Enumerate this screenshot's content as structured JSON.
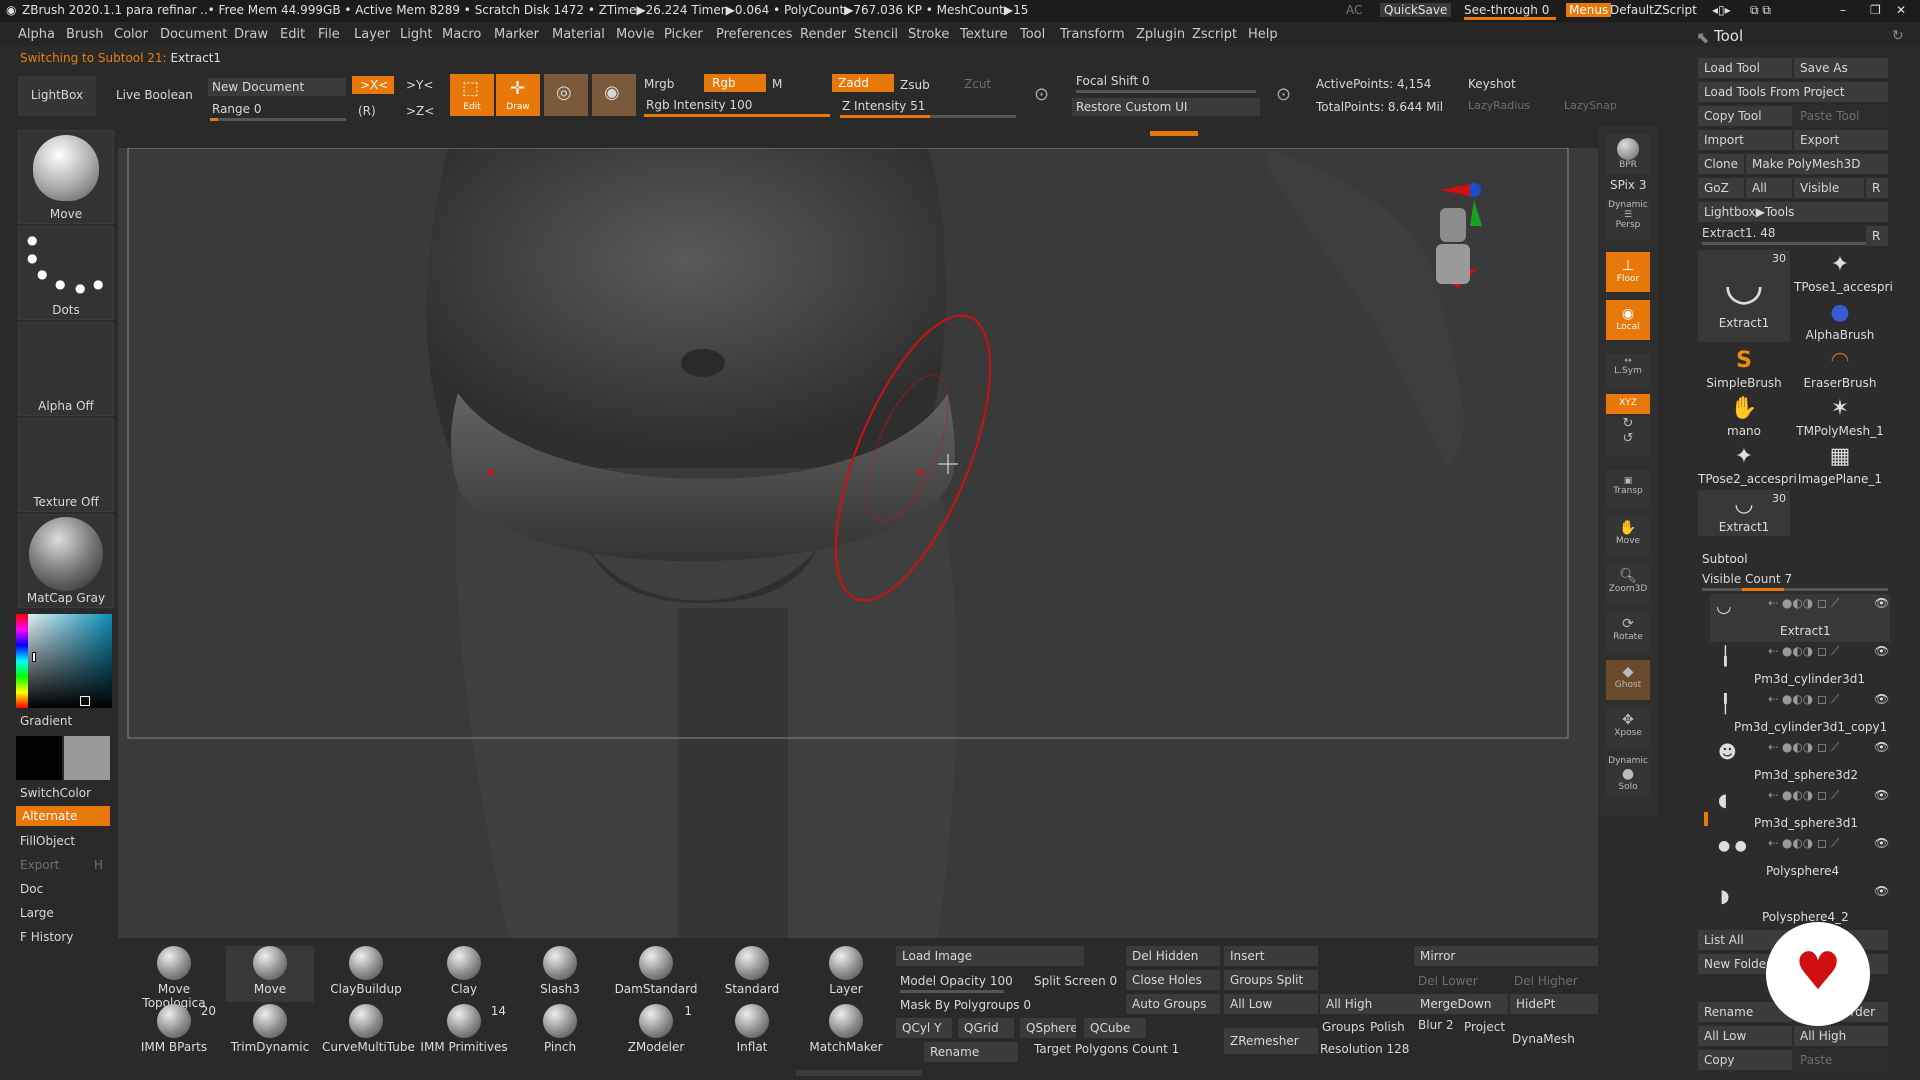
{
  "titlebar": {
    "app": "ZBrush 2020.1.1",
    "doc": "para refinar",
    "stats": "..• Free Mem 44.999GB • Active Mem 8289 • Scratch Disk 1472 • ZTime▶26.224 Timer▶0.064 • PolyCount▶767.036 KP • MeshCount▶15",
    "ac": "AC",
    "quicksave": "QuickSave",
    "see_through": "See-through",
    "see_through_val": "0",
    "menus": "Menus",
    "script": "DefaultZScript"
  },
  "menu": [
    "Alpha",
    "Brush",
    "Color",
    "Document",
    "Draw",
    "Edit",
    "File",
    "Layer",
    "Light",
    "Macro",
    "Marker",
    "Material",
    "Movie",
    "Picker",
    "Preferences",
    "Render",
    "Stencil",
    "Stroke",
    "Texture",
    "Tool",
    "Transform",
    "Zplugin",
    "Zscript",
    "Help"
  ],
  "note": {
    "prefix": "Switching to Subtool 21:",
    "name": "Extract1"
  },
  "top": {
    "lightbox": "LightBox",
    "live_boolean": "Live Boolean",
    "new_document": "New Document",
    "range": "Range 0",
    "x": ">X<",
    "y": ">Y<",
    "z": ">Z<",
    "r": "(R)",
    "edit": "Edit",
    "draw": "Draw",
    "mrgb": "Mrgb",
    "rgb": "Rgb",
    "m": "M",
    "rgb_intensity": "Rgb Intensity 100",
    "zadd": "Zadd",
    "zsub": "Zsub",
    "zcut": "Zcut",
    "z_intensity": "Z Intensity 51",
    "focal_shift": "Focal Shift 0",
    "restore_ui": "Restore Custom UI",
    "active_points": "ActivePoints: 4,154",
    "total_points": "TotalPoints: 8.644 Mil",
    "keyshot": "Keyshot",
    "lazy_radius": "LazyRadius",
    "lazy_snap": "LazySnap",
    "rgb_intensity_val": 100,
    "z_intensity_val": 51
  },
  "left": {
    "move": "Move",
    "dots": "Dots",
    "alpha_off": "Alpha Off",
    "texture_off": "Texture Off",
    "matcap": "MatCap Gray",
    "gradient": "Gradient",
    "switchcolor": "SwitchColor",
    "alternate": "Alternate",
    "fillobject": "FillObject",
    "export": "Export",
    "h": "H",
    "doc": "Doc",
    "large": "Large",
    "fhistory": "F History"
  },
  "right": {
    "bpr": "BPR",
    "spix": "SPix 3",
    "dynamic": "Dynamic",
    "persp": "Persp",
    "floor": "Floor",
    "local": "Local",
    "lsym": "L.Sym",
    "xyz": "XYZ",
    "transp": "Transp",
    "move": "Move",
    "zoom3d": "Zoom3D",
    "rotate": "Rotate",
    "ghost": "Ghost",
    "xpose": "Xpose",
    "solo": "Solo"
  },
  "tool": {
    "title": "Tool",
    "load": "Load Tool",
    "save_as": "Save As",
    "load_project": "Load Tools From Project",
    "copy": "Copy Tool",
    "paste": "Paste Tool",
    "import": "Import",
    "export": "Export",
    "clone": "Clone",
    "make_poly": "Make PolyMesh3D",
    "goz": "GoZ",
    "all": "All",
    "visible": "Visible",
    "r": "R",
    "lightbox_tools": "Lightbox▶Tools",
    "current": "Extract1. 48",
    "items": [
      {
        "name": "Extract1",
        "count": "30",
        "icon": "◡"
      },
      {
        "name": "TPose1_accespri",
        "icon": "✦"
      },
      {
        "name": "AlphaBrush",
        "icon": "●"
      },
      {
        "name": "SimpleBrush",
        "icon": "S"
      },
      {
        "name": "EraserBrush",
        "icon": "◠"
      },
      {
        "name": "mano",
        "icon": "✋"
      },
      {
        "name": "TMPolyMesh_1",
        "icon": "✶"
      },
      {
        "name": "TPose2_accespri",
        "icon": "✦"
      },
      {
        "name": "ImagePlane_1",
        "icon": "▦"
      },
      {
        "name": "Extract1",
        "count": "30",
        "icon": "◡"
      }
    ]
  },
  "subtool": {
    "title": "Subtool",
    "visible_count": "Visible Count 7",
    "items": [
      "Extract1",
      "Pm3d_cylinder3d1",
      "Pm3d_cylinder3d1_copy1",
      "Pm3d_sphere3d2",
      "Pm3d_sphere3d1",
      "Polysphere4",
      "Polysphere4_2"
    ],
    "list_all": "List All",
    "new_folder": "New Folder",
    "rename": "Rename",
    "autoreorder": "AutoReorder",
    "all_low": "All Low",
    "all_high": "All High",
    "copy": "Copy",
    "paste": "Paste"
  },
  "brushes": [
    {
      "name": "Move Topologica"
    },
    {
      "name": "Move"
    },
    {
      "name": "ClayBuildup"
    },
    {
      "name": "Clay"
    },
    {
      "name": "Slash3"
    },
    {
      "name": "DamStandard"
    },
    {
      "name": "Standard"
    },
    {
      "name": "Layer"
    },
    {
      "name": "IMM BParts",
      "count": "20"
    },
    {
      "name": "TrimDynamic"
    },
    {
      "name": "CurveMultiTube"
    },
    {
      "name": "IMM Primitives",
      "count": "14"
    },
    {
      "name": "Pinch"
    },
    {
      "name": "ZModeler",
      "count": "1"
    },
    {
      "name": "Inflat"
    },
    {
      "name": "MatchMaker"
    }
  ],
  "bottom": {
    "load_image": "Load Image",
    "model_opacity": "Model Opacity 100",
    "split_screen": "Split Screen 0",
    "mask_polygroups": "Mask By Polygroups 0",
    "qcyl": "QCyl Y",
    "qgrid": "QGrid",
    "qsphere": "QSphere",
    "qcube": "QCube",
    "rename": "Rename",
    "target_polys": "Target Polygons Count 1",
    "del_hidden": "Del Hidden",
    "insert": "Insert",
    "close_holes": "Close Holes",
    "groups_split": "Groups Split",
    "auto_groups": "Auto Groups",
    "all_low": "All Low",
    "all_high": "All High",
    "zremesher": "ZRemesher",
    "mirror": "Mirror",
    "del_lower": "Del Lower",
    "del_higher": "Del Higher",
    "mergedown": "MergeDown",
    "hidept": "HidePt",
    "groups": "Groups",
    "polish": "Polish",
    "blur": "Blur 2",
    "project": "Project",
    "resolution": "Resolution 128",
    "dynamesh": "DynaMesh"
  },
  "colors": {
    "accent": "#e8780a"
  }
}
